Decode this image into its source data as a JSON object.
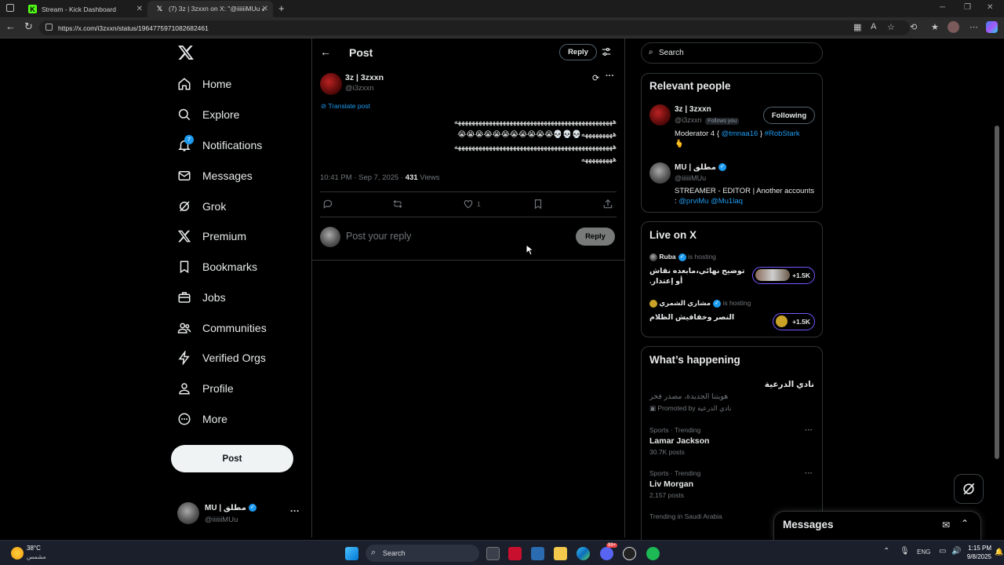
{
  "browser": {
    "tabs": [
      {
        "title": "Stream - Kick Dashboard",
        "icon": "kick-icon",
        "active": false
      },
      {
        "title": "(7) 3z | 3zxxn on X: \"@iiiiiiMUu ه...",
        "icon": "x-icon",
        "active": true
      }
    ],
    "url": "https://x.com/i3zxxn/status/1964775971082682461"
  },
  "nav": {
    "items": [
      {
        "label": "Home",
        "icon": "home-icon"
      },
      {
        "label": "Explore",
        "icon": "search-icon"
      },
      {
        "label": "Notifications",
        "icon": "bell-icon"
      },
      {
        "label": "Messages",
        "icon": "envelope-icon"
      },
      {
        "label": "Grok",
        "icon": "grok-icon"
      },
      {
        "label": "Premium",
        "icon": "x-logo-icon"
      },
      {
        "label": "Bookmarks",
        "icon": "bookmark-icon"
      },
      {
        "label": "Jobs",
        "icon": "briefcase-icon"
      },
      {
        "label": "Communities",
        "icon": "people-icon"
      },
      {
        "label": "Verified Orgs",
        "icon": "lightning-icon"
      },
      {
        "label": "Profile",
        "icon": "person-icon"
      },
      {
        "label": "More",
        "icon": "more-circle-icon"
      }
    ],
    "notification_badge": "7",
    "post_button": "Post",
    "account": {
      "name": "MU | مطلق",
      "handle": "@iiiiiiMUu"
    }
  },
  "post": {
    "header_title": "Post",
    "reply_button": "Reply",
    "author_name": "3z | 3zxxn",
    "author_handle": "@i3zxxn",
    "translate": "Translate post",
    "body_lines": [
      "ههههههههههههههههههههههههههههههههههههههههههههههه",
      "هههههههههه💀💀💀😭😭😭😭😭😭😭😭😭😭😭",
      "ههههههههههههههههههههههههههههههههههههههههههههههه",
      "هههههههههه"
    ],
    "timestamp": "10:41 PM · Sep 7, 2025 ·",
    "views_count": "431",
    "views_label": "Views",
    "like_count": "1",
    "reply_placeholder": "Post your reply",
    "reply_submit": "Reply"
  },
  "sidebar": {
    "search_placeholder": "Search",
    "relevant": {
      "title": "Relevant people",
      "people": [
        {
          "name": "3z | 3zxxn",
          "handle": "@i3zxxn",
          "follows_you": "Follows you",
          "follow_button": "Following",
          "bio_prefix": "Moderator 4 { ",
          "bio_mention": "@tmnaa16",
          "bio_mid": " } ",
          "bio_tag": "#RobStark",
          "bio_emoji": "🫰"
        },
        {
          "name": "MU | مطلق",
          "handle": "@iiiiiiMUu",
          "bio_text": "STREAMER - EDITOR | Another accounts : ",
          "bio_link1": "@prviMu",
          "bio_link2": "@Mu1laq"
        }
      ]
    },
    "live": {
      "title": "Live on X",
      "items": [
        {
          "host": "Ruba",
          "status": "is hosting",
          "title": "توضيح نهائي،مابعده نقاش أو إعتذار.",
          "count": "+1.5K"
        },
        {
          "host": "مشاري الشمري",
          "status": "is hosting",
          "title": "النصر وخفافيش الظلام",
          "count": "+1.5K"
        }
      ]
    },
    "happening": {
      "title": "What’s happening",
      "promo": {
        "title": "نادي الدرعية",
        "subtitle": "هويتنا الجديدة، مصدر فخر",
        "promoted": "Promoted by نادي الدرعية"
      },
      "trends": [
        {
          "context": "Sports · Trending",
          "name": "Lamar Jackson",
          "posts": "30.7K posts"
        },
        {
          "context": "Sports · Trending",
          "name": "Liv Morgan",
          "posts": "2,157 posts"
        },
        {
          "context": "Trending in Saudi Arabia",
          "name": "",
          "posts": ""
        }
      ]
    },
    "messages_drawer": "Messages"
  },
  "taskbar": {
    "weather_temp": "38°C",
    "weather_label": "مشمس",
    "search": "Search",
    "lang": "ENG",
    "time": "1:15 PM",
    "date": "9/8/2025",
    "discord_badge": "99+"
  },
  "colors": {
    "accent": "#1d9bf0",
    "bg": "#000000",
    "border": "#2f3336",
    "muted": "#71767b"
  }
}
